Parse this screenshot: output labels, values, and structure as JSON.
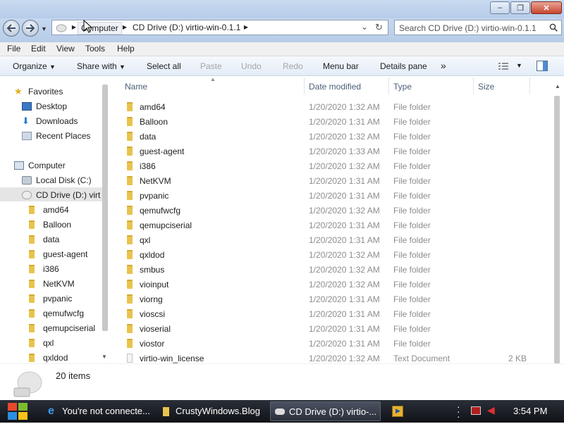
{
  "window": {
    "minimize": "–",
    "maximize": "❐",
    "close": "✕"
  },
  "address": {
    "crumbs": [
      "Computer",
      "CD Drive (D:) virtio-win-0.1.1"
    ],
    "dropdown": "⌄",
    "refresh": "↻"
  },
  "search": {
    "placeholder": "Search CD Drive (D:) virtio-win-0.1.1"
  },
  "menu": [
    "File",
    "Edit",
    "View",
    "Tools",
    "Help"
  ],
  "toolbar": {
    "organize": "Organize",
    "share_with": "Share with",
    "select_all": "Select all",
    "paste": "Paste",
    "undo": "Undo",
    "redo": "Redo",
    "menu_bar": "Menu bar",
    "details_pane": "Details pane",
    "more": "»"
  },
  "nav": {
    "favorites": "Favorites",
    "favorites_items": [
      "Desktop",
      "Downloads",
      "Recent Places"
    ],
    "computer": "Computer",
    "drives": [
      "Local Disk (C:)",
      "CD Drive (D:) virt"
    ],
    "folders": [
      "amd64",
      "Balloon",
      "data",
      "guest-agent",
      "i386",
      "NetKVM",
      "pvpanic",
      "qemufwcfg",
      "qemupciserial",
      "qxl",
      "qxldod"
    ]
  },
  "columns": {
    "name": "Name",
    "date": "Date modified",
    "type": "Type",
    "size": "Size"
  },
  "files": [
    {
      "name": "amd64",
      "date": "1/20/2020 1:32 AM",
      "type": "File folder",
      "size": ""
    },
    {
      "name": "Balloon",
      "date": "1/20/2020 1:31 AM",
      "type": "File folder",
      "size": ""
    },
    {
      "name": "data",
      "date": "1/20/2020 1:32 AM",
      "type": "File folder",
      "size": ""
    },
    {
      "name": "guest-agent",
      "date": "1/20/2020 1:33 AM",
      "type": "File folder",
      "size": ""
    },
    {
      "name": "i386",
      "date": "1/20/2020 1:32 AM",
      "type": "File folder",
      "size": ""
    },
    {
      "name": "NetKVM",
      "date": "1/20/2020 1:31 AM",
      "type": "File folder",
      "size": ""
    },
    {
      "name": "pvpanic",
      "date": "1/20/2020 1:31 AM",
      "type": "File folder",
      "size": ""
    },
    {
      "name": "qemufwcfg",
      "date": "1/20/2020 1:32 AM",
      "type": "File folder",
      "size": ""
    },
    {
      "name": "qemupciserial",
      "date": "1/20/2020 1:31 AM",
      "type": "File folder",
      "size": ""
    },
    {
      "name": "qxl",
      "date": "1/20/2020 1:31 AM",
      "type": "File folder",
      "size": ""
    },
    {
      "name": "qxldod",
      "date": "1/20/2020 1:32 AM",
      "type": "File folder",
      "size": ""
    },
    {
      "name": "smbus",
      "date": "1/20/2020 1:32 AM",
      "type": "File folder",
      "size": ""
    },
    {
      "name": "vioinput",
      "date": "1/20/2020 1:32 AM",
      "type": "File folder",
      "size": ""
    },
    {
      "name": "viorng",
      "date": "1/20/2020 1:31 AM",
      "type": "File folder",
      "size": ""
    },
    {
      "name": "vioscsi",
      "date": "1/20/2020 1:31 AM",
      "type": "File folder",
      "size": ""
    },
    {
      "name": "vioserial",
      "date": "1/20/2020 1:31 AM",
      "type": "File folder",
      "size": ""
    },
    {
      "name": "viostor",
      "date": "1/20/2020 1:31 AM",
      "type": "File folder",
      "size": ""
    },
    {
      "name": "virtio-win_license",
      "date": "1/20/2020 1:32 AM",
      "type": "Text Document",
      "size": "2 KB"
    }
  ],
  "status": {
    "item_count": "20 items"
  },
  "taskbar": {
    "tasks": [
      "You're not connecte...",
      "CrustyWindows.Blog",
      "CD Drive (D:) virtio-..."
    ],
    "clock": "3:54 PM"
  },
  "colors": {
    "folder": "#e8c44e",
    "titlebar": "#c9daf0",
    "taskbar": "#1b1e24",
    "accent": "#4c607a"
  }
}
